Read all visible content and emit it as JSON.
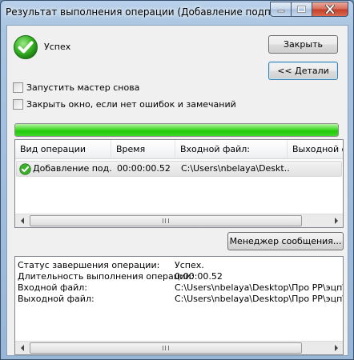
{
  "window": {
    "title": "Результат выполнения операции (Добавление подписи)"
  },
  "icons": {
    "success": "checkmark-success-icon",
    "row_status": "checkmark-success-icon",
    "minimize": "minimize-icon",
    "maximize": "maximize-icon",
    "close": "close-icon",
    "scroll_left": "arrow-left-icon",
    "scroll_right": "arrow-right-icon",
    "scroll_grip": "grip-icon"
  },
  "status": {
    "label": "Успех"
  },
  "buttons": {
    "close_label": "Закрыть",
    "details_label": "<< Детали",
    "message_manager_label": "Менеджер сообщения..."
  },
  "options": {
    "rerun_wizard": {
      "label": "Запустить мастер снова",
      "checked": false
    },
    "close_if_no_errors": {
      "label": "Закрыть окно, если нет ошибок и замечаний",
      "checked": false
    }
  },
  "progress": {
    "percent": 100
  },
  "operations": {
    "columns": [
      "Вид операции",
      "Время",
      "Входной файл:",
      "Выходной ф"
    ],
    "rows": [
      {
        "type": "Добавление под...",
        "time": "00:00:00.52",
        "input": "C:\\Users\\nbelaya\\Deskt..."
      }
    ]
  },
  "details": {
    "rows": [
      {
        "label": "Статус завершения операции:",
        "value": "Успех."
      },
      {
        "label": "Длительность выполнения операции:",
        "value": "0:00:00.52"
      },
      {
        "label": "Входной файл:",
        "value": "C:\\Users\\nbelaya\\Desktop\\Про PP\\эцп\\Dog"
      },
      {
        "label": "Выходной файл:",
        "value": "C:\\Users\\nbelaya\\Desktop\\Про PP\\эцп\\Dog"
      }
    ]
  },
  "colors": {
    "accent_green": "#22c90a",
    "title_gradient": "#a9c4e1",
    "close_button": "#c5402a"
  }
}
